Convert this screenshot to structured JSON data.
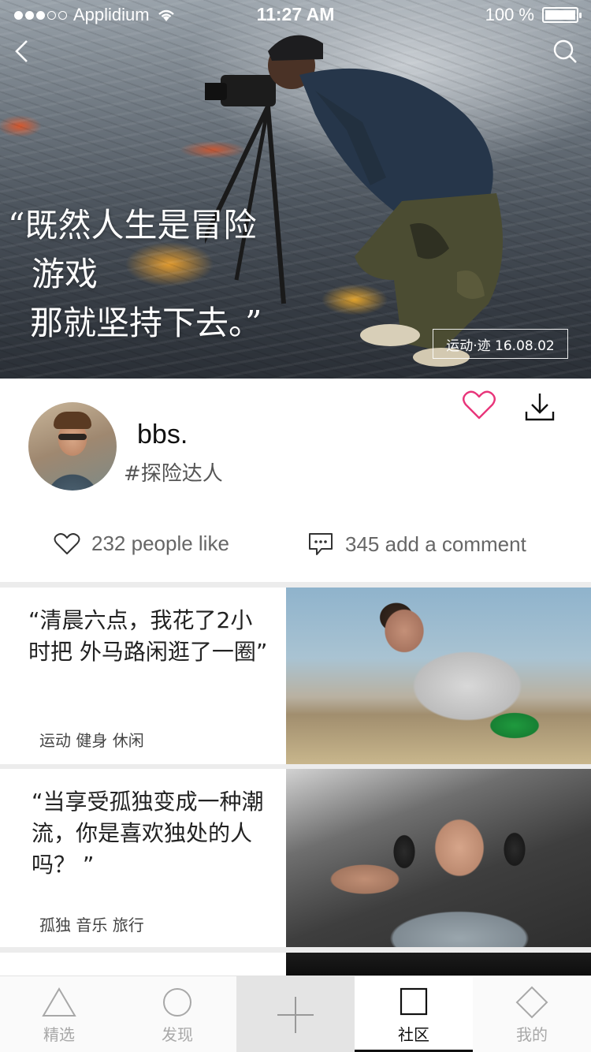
{
  "status_bar": {
    "carrier": "Applidium",
    "time": "11:27 AM",
    "battery": "100 %"
  },
  "hero": {
    "quote_line1": "“既然人生是冒险",
    "quote_line2": "游戏",
    "quote_line3": "那就坚持下去。”",
    "tag": "运动·迹 16.08.02"
  },
  "profile": {
    "name": "bbs.",
    "tag": "#探险达人",
    "likes_text": "232 people like",
    "comments_text": "345 add a comment"
  },
  "feed": [
    {
      "quote": "“清晨六点，我花了2小时把 外马路闲逛了一圈”",
      "tags": "运动  健身  休闲"
    },
    {
      "quote": "“当享受孤独变成一种潮流，你是喜欢独处的人吗？ ”",
      "tags": "孤独  音乐  旅行"
    }
  ],
  "tabbar": {
    "tabs": [
      {
        "label": "精选",
        "icon": "triangle-icon"
      },
      {
        "label": "发现",
        "icon": "circle-icon"
      },
      {
        "label": "",
        "icon": "plus-icon"
      },
      {
        "label": "社区",
        "icon": "square-icon"
      },
      {
        "label": "我的",
        "icon": "diamond-icon"
      }
    ]
  },
  "colors": {
    "heart_accent": "#e8357a",
    "active_tab": "#111111",
    "inactive_tab": "#a8a8a8"
  }
}
